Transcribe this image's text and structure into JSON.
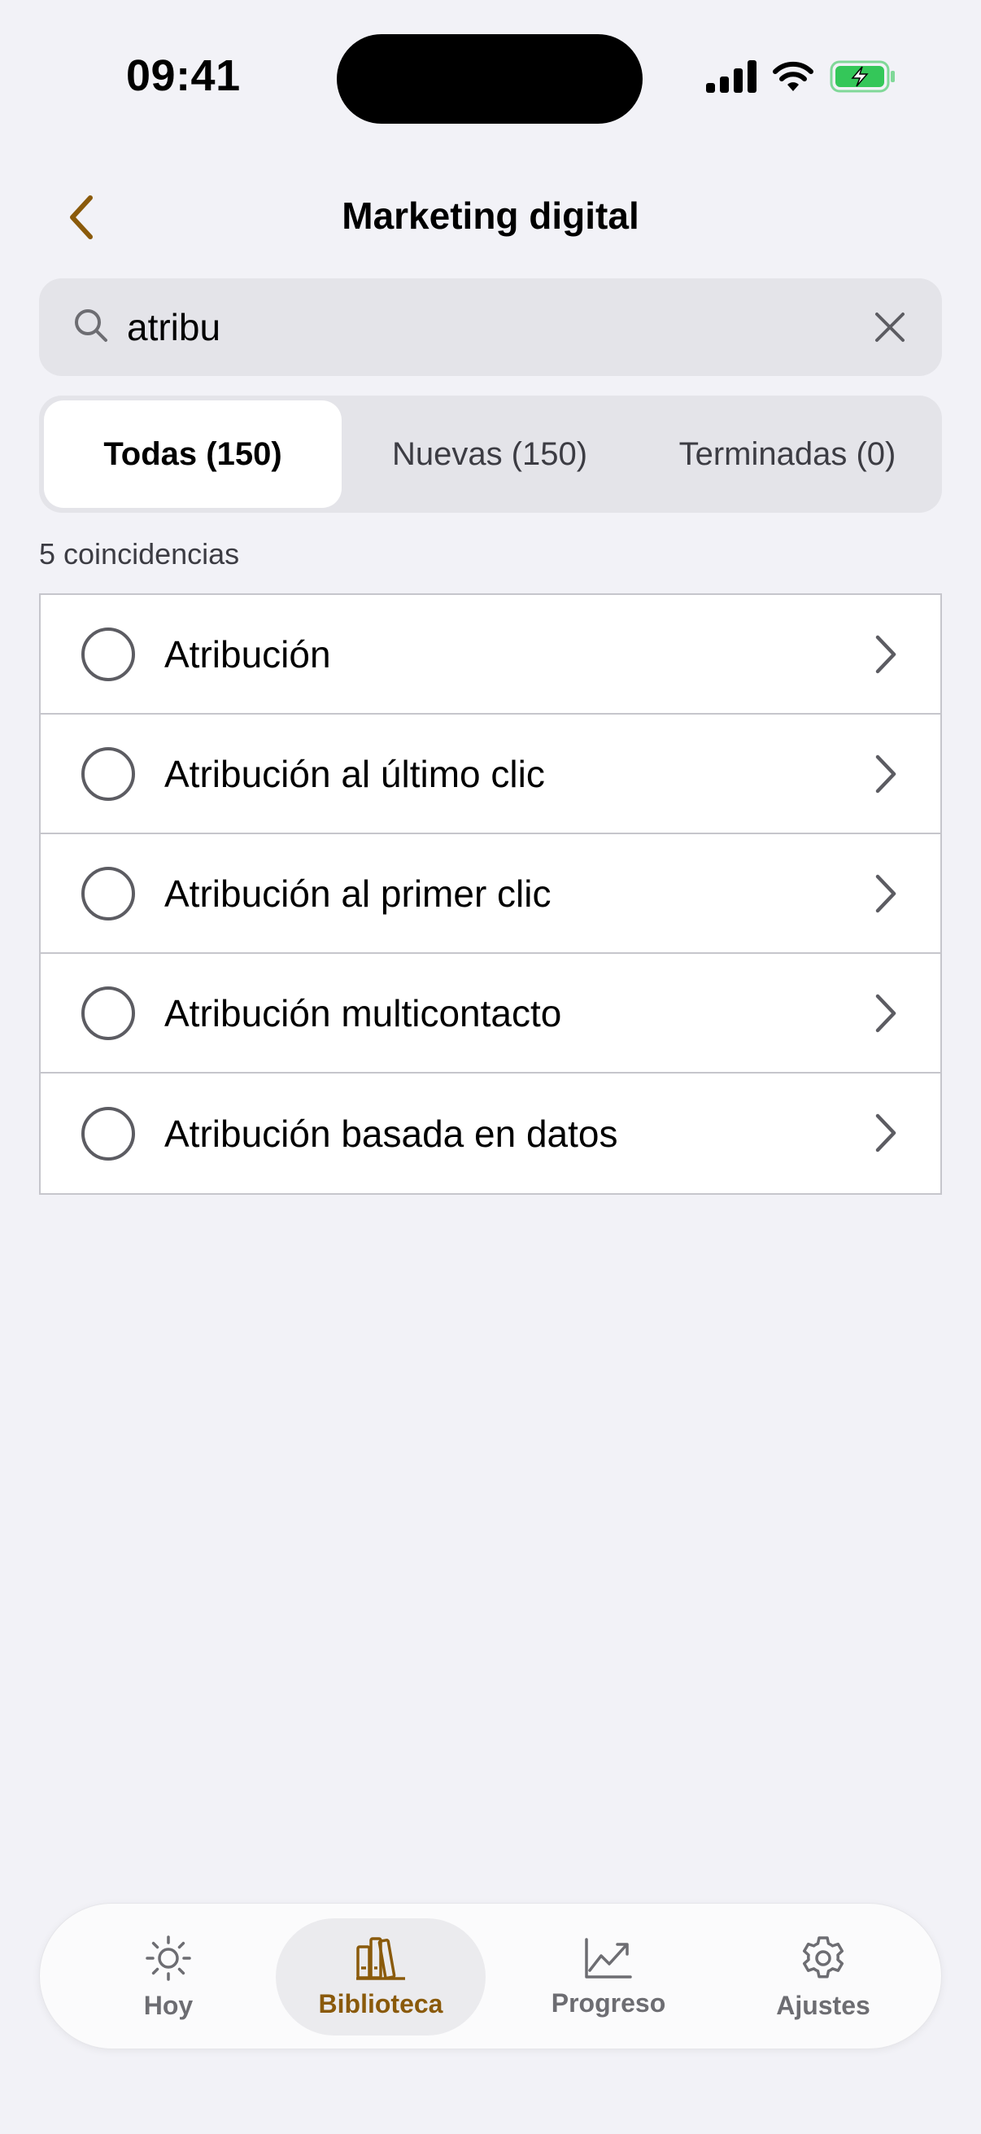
{
  "status": {
    "time": "09:41"
  },
  "nav": {
    "title": "Marketing digital"
  },
  "search": {
    "value": "atribu"
  },
  "segments": [
    {
      "label": "Todas (150)",
      "active": true
    },
    {
      "label": "Nuevas (150)",
      "active": false
    },
    {
      "label": "Terminadas (0)",
      "active": false
    }
  ],
  "match_count": "5 coincidencias",
  "results": [
    {
      "label": "Atribución"
    },
    {
      "label": "Atribución al último clic"
    },
    {
      "label": "Atribución al primer clic"
    },
    {
      "label": "Atribución multicontacto"
    },
    {
      "label": "Atribución basada en datos"
    }
  ],
  "tabbar": {
    "items": [
      {
        "label": "Hoy",
        "icon": "sun-icon",
        "active": false
      },
      {
        "label": "Biblioteca",
        "icon": "books-icon",
        "active": true
      },
      {
        "label": "Progreso",
        "icon": "chart-icon",
        "active": false
      },
      {
        "label": "Ajustes",
        "icon": "gear-icon",
        "active": false
      }
    ]
  },
  "colors": {
    "accent": "#8A5A0B",
    "background": "#F2F2F7",
    "battery": "#34C759"
  }
}
